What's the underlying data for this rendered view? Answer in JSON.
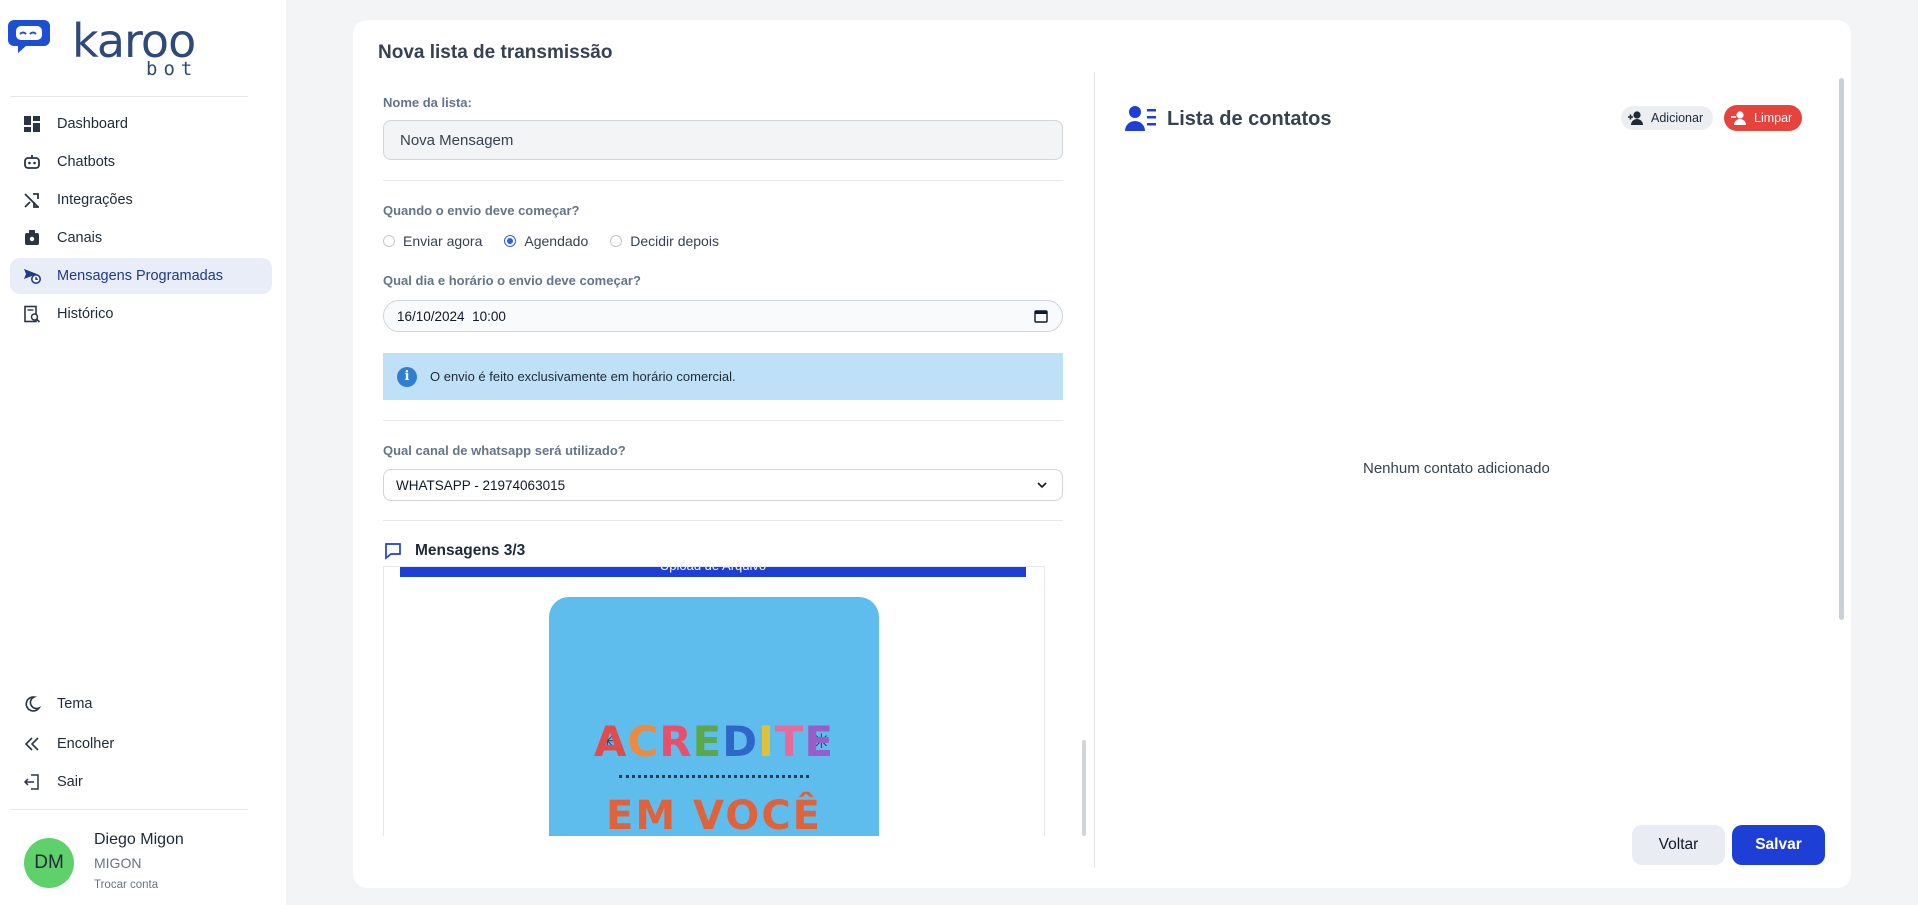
{
  "brand": {
    "logo_word": "karoo",
    "logo_sub": "bot"
  },
  "sidebar": {
    "items": [
      {
        "label": "Dashboard",
        "icon": "dashboard-icon"
      },
      {
        "label": "Chatbots",
        "icon": "robot-icon"
      },
      {
        "label": "Integrações",
        "icon": "shuffle-icon"
      },
      {
        "label": "Canais",
        "icon": "channel-icon"
      },
      {
        "label": "Mensagens Programadas",
        "icon": "scheduled-message-icon",
        "active": true
      },
      {
        "label": "Histórico",
        "icon": "history-icon"
      }
    ],
    "bottom": [
      {
        "label": "Tema",
        "icon": "moon-icon"
      },
      {
        "label": "Encolher",
        "icon": "double-chevron-left-icon"
      },
      {
        "label": "Sair",
        "icon": "logout-icon"
      }
    ],
    "user": {
      "initials": "DM",
      "name": "Diego Migon",
      "company": "MIGON",
      "switch_label": "Trocar conta"
    }
  },
  "form": {
    "title": "Nova lista de transmissão",
    "name_label": "Nome da lista:",
    "name_value": "Nova Mensagem",
    "start_label": "Quando o envio deve começar?",
    "start_options": [
      "Enviar agora",
      "Agendado",
      "Decidir depois"
    ],
    "start_selected": "Agendado",
    "datetime_label": "Qual dia e horário o envio deve começar?",
    "datetime_value": "16/10/2024  10:00",
    "info_text": "O envio é feito exclusivamente em horário comercial.",
    "channel_label": "Qual canal de whatsapp será utilizado?",
    "channel_value": "WHATSAPP - 21974063015",
    "messages_title": "Mensagens 3/3",
    "upload_label": "Upload de Arquivo",
    "preview_word1": "ACREDITE",
    "preview_word2": "EM VOCÊ"
  },
  "contacts": {
    "title": "Lista de contatos",
    "add_label": "Adicionar",
    "clear_label": "Limpar",
    "empty_text": "Nenhum contato adicionado"
  },
  "actions": {
    "back_label": "Voltar",
    "save_label": "Salvar"
  },
  "colors": {
    "primary": "#1d3fd6",
    "danger": "#e5433c",
    "info_bg": "#bfe1f7",
    "avatar": "#5fd16b"
  }
}
